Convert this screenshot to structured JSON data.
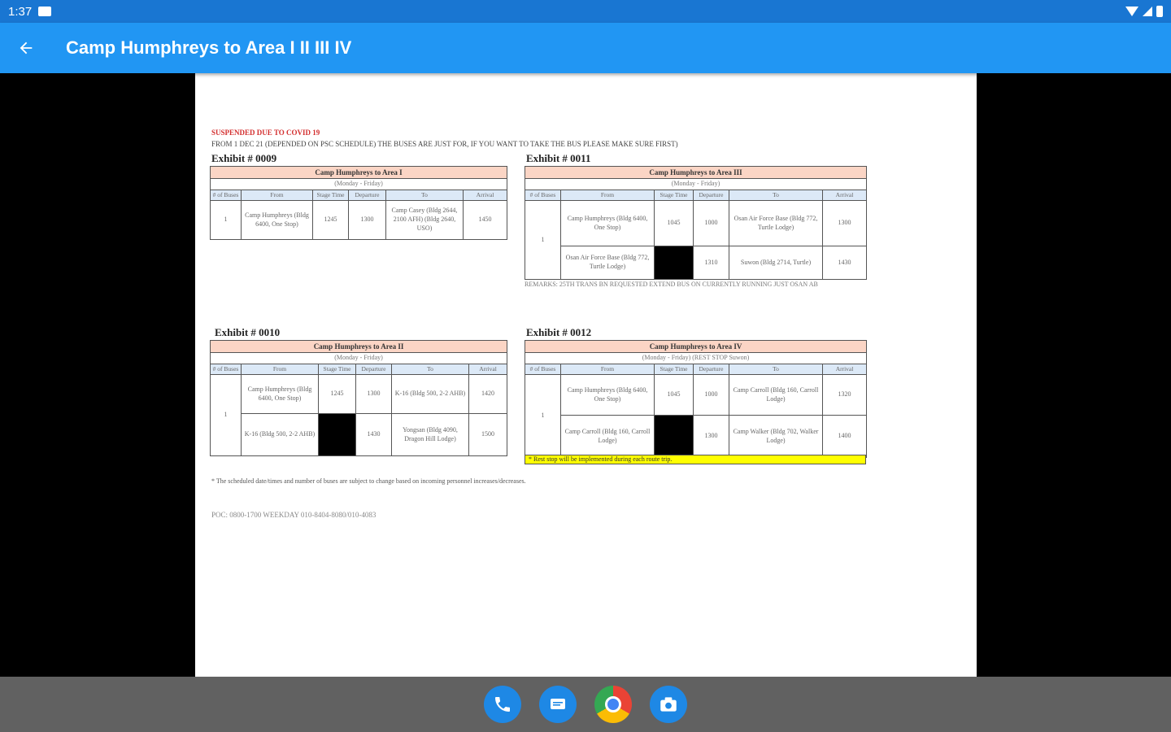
{
  "status": {
    "time": "1:37"
  },
  "app": {
    "title": "Camp Humphreys to Area I II III IV"
  },
  "doc": {
    "suspended": "SUSPENDED DUE TO COVID 19",
    "notice": "FROM 1 DEC 21 (DEPENDED ON PSC SCHEDULE) THE BUSES ARE JUST FOR, IF YOU WANT TO TAKE THE BUS PLEASE MAKE SURE FIRST)",
    "ex1": {
      "title": "Exhibit # 0009",
      "route": "Camp Humphreys to Area I",
      "days": "(Monday - Friday)",
      "cols": [
        "# of Buses",
        "From",
        "Stage Time",
        "Departure",
        "To",
        "Arrival"
      ],
      "buses": "1",
      "from": "Camp Humphreys (Bldg 6400, One Stop)",
      "stage": "1245",
      "dep": "1300",
      "to": "Camp Casey (Bldg 2644, 2100 AFH) (Bldg 2640, USO)",
      "arr": "1450"
    },
    "ex2": {
      "title": "Exhibit # 0011",
      "route": "Camp Humphreys to Area III",
      "days": "(Monday - Friday)",
      "cols": [
        "# of Buses",
        "From",
        "Stage Time",
        "Departure",
        "To",
        "Arrival"
      ],
      "buses": "1",
      "r1": {
        "from": "Camp Humphreys (Bldg 6400, One Stop)",
        "stage": "1045",
        "dep": "1000",
        "to": "Osan Air Force Base (Bldg 772, Turtle Lodge)",
        "arr": "1300"
      },
      "r2": {
        "from": "Osan Air Force Base (Bldg 772, Turtle Lodge)",
        "dep": "1310",
        "to": "Suwon (Bldg 2714, Turtle)",
        "arr": "1430"
      },
      "remarks": "REMARKS: 25TH TRANS BN REQUESTED EXTEND BUS ON CURRENTLY RUNNING JUST OSAN AB"
    },
    "ex3": {
      "title": "Exhibit # 0010",
      "route": "Camp Humphreys to Area II",
      "days": "(Monday - Friday)",
      "cols": [
        "# of Buses",
        "From",
        "Stage Time",
        "Departure",
        "To",
        "Arrival"
      ],
      "buses": "1",
      "r1": {
        "from": "Camp Humphreys (Bldg 6400, One Stop)",
        "stage": "1245",
        "dep": "1300",
        "to": "K-16 (Bldg 500, 2-2 AHB)",
        "arr": "1420"
      },
      "r2": {
        "from": "K-16 (Bldg 500, 2-2 AHB)",
        "dep": "1430",
        "to": "Yongsan (Bldg 4090, Dragon Hill Lodge)",
        "arr": "1500"
      }
    },
    "ex4": {
      "title": "Exhibit # 0012",
      "route": "Camp Humphreys to Area IV",
      "days": "(Monday - Friday) (REST STOP Suwon)",
      "cols": [
        "# of Buses",
        "From",
        "Stage Time",
        "Departure",
        "To",
        "Arrival"
      ],
      "buses": "1",
      "r1": {
        "from": "Camp Humphreys (Bldg 6400, One Stop)",
        "stage": "1045",
        "dep": "1000",
        "to": "Camp Carroll (Bldg 160, Carroll Lodge)",
        "arr": "1320"
      },
      "r2": {
        "from": "Camp Carroll (Bldg 160, Carroll Lodge)",
        "dep": "1300",
        "to": "Camp Walker (Bldg 702, Walker Lodge)",
        "arr": "1400"
      },
      "reststop": "* Rest stop will be implemented during each route trip."
    },
    "footnote": "* The scheduled date/times and number of buses are subject to change based on incoming personnel increases/decreases.",
    "poc": "POC: 0800-1700 WEEKDAY 010-8404-8080/010-4083"
  }
}
